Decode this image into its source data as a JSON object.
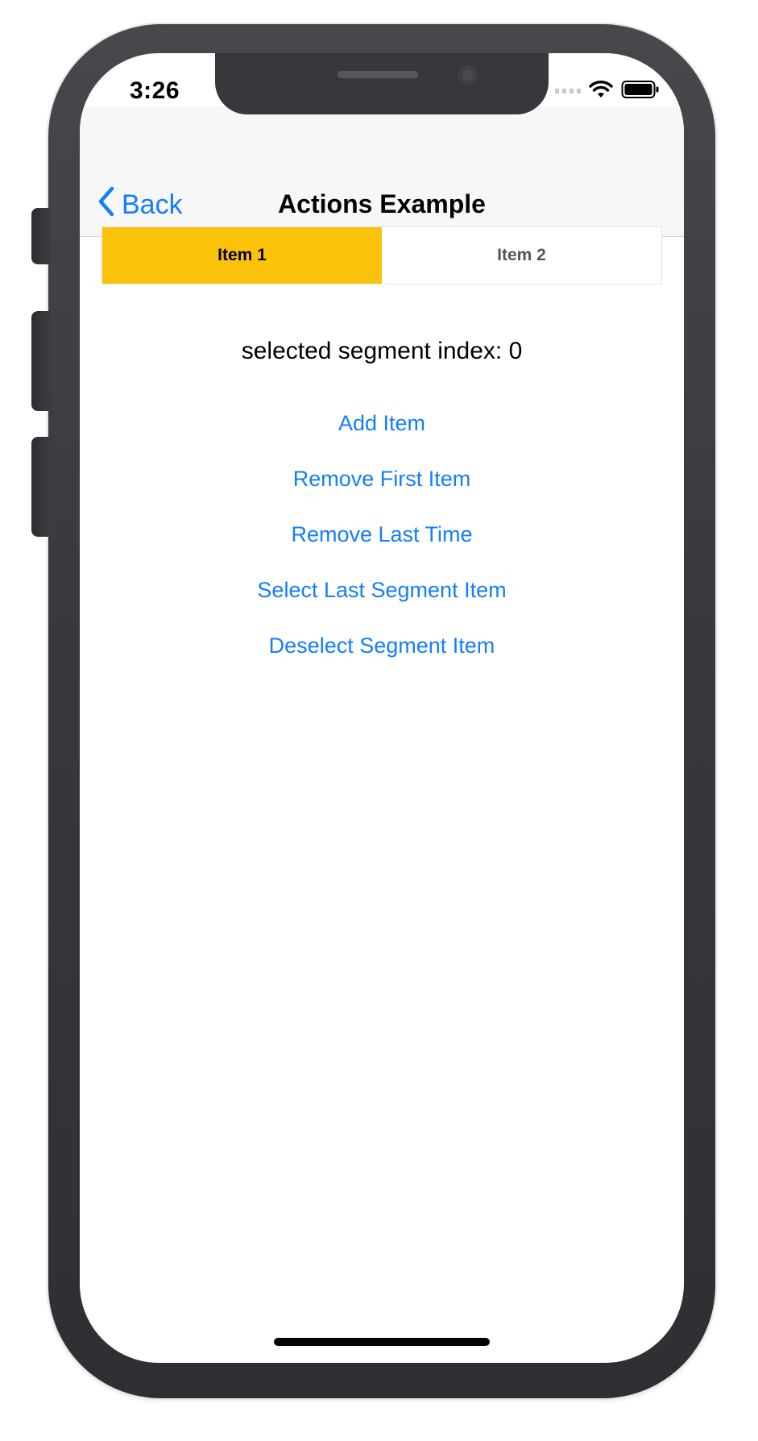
{
  "status_bar": {
    "time": "3:26",
    "icons": [
      "cellular-signal-icon",
      "wifi-icon",
      "battery-icon"
    ]
  },
  "navbar": {
    "back_label": "Back",
    "title": "Actions Example"
  },
  "segmented_control": {
    "items": [
      {
        "label": "Item 1",
        "selected": true
      },
      {
        "label": "Item 2",
        "selected": false
      }
    ]
  },
  "content": {
    "index_label": "selected segment index: 0",
    "actions": [
      {
        "label": "Add Item"
      },
      {
        "label": "Remove First Item"
      },
      {
        "label": "Remove Last Time"
      },
      {
        "label": "Select Last Segment Item"
      },
      {
        "label": "Deselect Segment Item"
      }
    ]
  },
  "colors": {
    "accent": "#147efb",
    "selected_segment": "#fbc20b",
    "frame": "#3a3a3e"
  }
}
